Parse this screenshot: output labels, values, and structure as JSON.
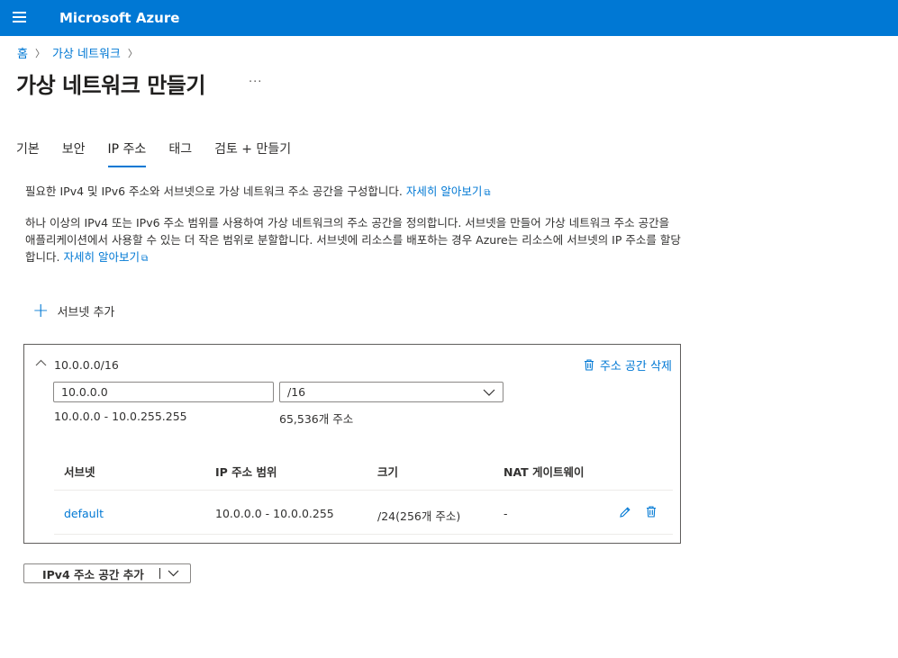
{
  "header": {
    "brand": "Microsoft Azure"
  },
  "breadcrumb": {
    "home": "홈",
    "vnet": "가상 네트워크"
  },
  "page": {
    "title": "가상 네트워크 만들기",
    "more": "···"
  },
  "tabs": [
    {
      "label": "기본"
    },
    {
      "label": "보안"
    },
    {
      "label": "IP 주소"
    },
    {
      "label": "태그"
    },
    {
      "label": "검토 + 만들기"
    }
  ],
  "description": {
    "line1": "필요한 IPv4 및 IPv6 주소와 서브넷으로 가상 네트워크 주소 공간을 구성합니다.",
    "line2": "하나 이상의 IPv4 또는 IPv6 주소 범위를 사용하여 가상 네트워크의 주소 공간을 정의합니다. 서브넷을 만들어 가상 네트워크 주소 공간을 애플리케이션에서 사용할 수 있는 더 작은 범위로 분할합니다. 서브넷에 리소스를 배포하는 경우 Azure는 리소스에 서브넷의 IP 주소를 할당합니다.",
    "learn_more": "자세히 알아보기"
  },
  "add_subnet": {
    "label": "서브넷 추가"
  },
  "address_space": {
    "cidr": "10.0.0.0/16",
    "delete_label": "주소 공간 삭제",
    "address_value": "10.0.0.0",
    "prefix_value": "/16",
    "range": "10.0.0.0 - 10.0.255.255",
    "count": "65,536개 주소"
  },
  "subnet_table": {
    "headers": {
      "subnet": "서브넷",
      "ip_range": "IP 주소 범위",
      "size": "크기",
      "nat": "NAT 게이트웨이"
    },
    "rows": [
      {
        "name": "default",
        "ip_range": "10.0.0.0 - 10.0.0.255",
        "size": "/24(256개 주소)",
        "nat": "-"
      }
    ]
  },
  "add_ipv4": {
    "label": "IPv4 주소 공간 추가"
  },
  "colors": {
    "accent": "#0078d4",
    "text": "#323130"
  }
}
